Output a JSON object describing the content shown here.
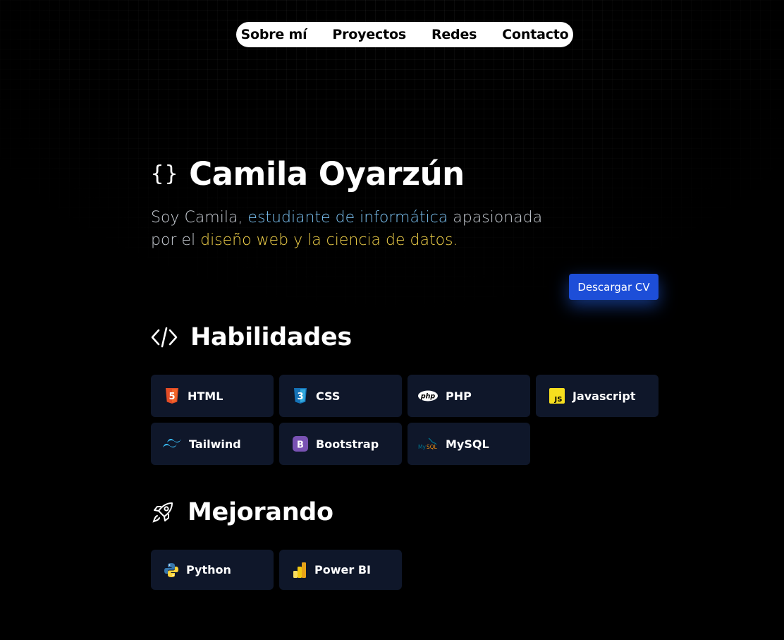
{
  "nav": {
    "items": [
      {
        "label": "Sobre mí"
      },
      {
        "label": "Proyectos"
      },
      {
        "label": "Redes"
      },
      {
        "label": "Contacto"
      }
    ]
  },
  "hero": {
    "braces": "{}",
    "name": "Camila Oyarzún",
    "intro_part1": "Soy Camila, ",
    "intro_highlight1": "estudiante de informática",
    "intro_part2": " apasionada por el ",
    "intro_highlight2": "diseño web y la ciencia de datos.",
    "cv_button": "Descargar CV"
  },
  "skills": {
    "title": "Habilidades",
    "icon": "code-icon",
    "items": [
      {
        "label": "HTML",
        "icon": "html5-icon"
      },
      {
        "label": "CSS",
        "icon": "css3-icon"
      },
      {
        "label": "PHP",
        "icon": "php-icon"
      },
      {
        "label": "Javascript",
        "icon": "javascript-icon"
      },
      {
        "label": "Tailwind",
        "icon": "tailwind-icon"
      },
      {
        "label": "Bootstrap",
        "icon": "bootstrap-icon"
      },
      {
        "label": "MySQL",
        "icon": "mysql-icon"
      }
    ]
  },
  "improving": {
    "title": "Mejorando",
    "icon": "rocket-icon",
    "items": [
      {
        "label": "Python",
        "icon": "python-icon"
      },
      {
        "label": "Power BI",
        "icon": "powerbi-icon"
      }
    ]
  },
  "colors": {
    "accent_blue": "#1d4ed8",
    "highlight_blue": "#7cc4f5",
    "highlight_yellow": "#f2d24a",
    "chip_bg": "#0f172a"
  }
}
